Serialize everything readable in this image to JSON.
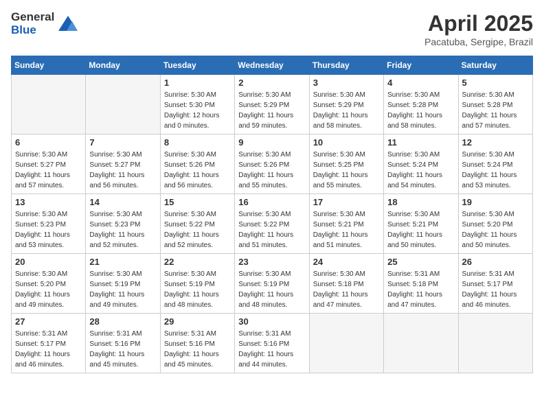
{
  "header": {
    "logo_general": "General",
    "logo_blue": "Blue",
    "month_title": "April 2025",
    "subtitle": "Pacatuba, Sergipe, Brazil"
  },
  "weekdays": [
    "Sunday",
    "Monday",
    "Tuesday",
    "Wednesday",
    "Thursday",
    "Friday",
    "Saturday"
  ],
  "weeks": [
    [
      {
        "day": "",
        "sunrise": "",
        "sunset": "",
        "daylight": ""
      },
      {
        "day": "",
        "sunrise": "",
        "sunset": "",
        "daylight": ""
      },
      {
        "day": "1",
        "sunrise": "Sunrise: 5:30 AM",
        "sunset": "Sunset: 5:30 PM",
        "daylight": "Daylight: 12 hours and 0 minutes."
      },
      {
        "day": "2",
        "sunrise": "Sunrise: 5:30 AM",
        "sunset": "Sunset: 5:29 PM",
        "daylight": "Daylight: 11 hours and 59 minutes."
      },
      {
        "day": "3",
        "sunrise": "Sunrise: 5:30 AM",
        "sunset": "Sunset: 5:29 PM",
        "daylight": "Daylight: 11 hours and 58 minutes."
      },
      {
        "day": "4",
        "sunrise": "Sunrise: 5:30 AM",
        "sunset": "Sunset: 5:28 PM",
        "daylight": "Daylight: 11 hours and 58 minutes."
      },
      {
        "day": "5",
        "sunrise": "Sunrise: 5:30 AM",
        "sunset": "Sunset: 5:28 PM",
        "daylight": "Daylight: 11 hours and 57 minutes."
      }
    ],
    [
      {
        "day": "6",
        "sunrise": "Sunrise: 5:30 AM",
        "sunset": "Sunset: 5:27 PM",
        "daylight": "Daylight: 11 hours and 57 minutes."
      },
      {
        "day": "7",
        "sunrise": "Sunrise: 5:30 AM",
        "sunset": "Sunset: 5:27 PM",
        "daylight": "Daylight: 11 hours and 56 minutes."
      },
      {
        "day": "8",
        "sunrise": "Sunrise: 5:30 AM",
        "sunset": "Sunset: 5:26 PM",
        "daylight": "Daylight: 11 hours and 56 minutes."
      },
      {
        "day": "9",
        "sunrise": "Sunrise: 5:30 AM",
        "sunset": "Sunset: 5:26 PM",
        "daylight": "Daylight: 11 hours and 55 minutes."
      },
      {
        "day": "10",
        "sunrise": "Sunrise: 5:30 AM",
        "sunset": "Sunset: 5:25 PM",
        "daylight": "Daylight: 11 hours and 55 minutes."
      },
      {
        "day": "11",
        "sunrise": "Sunrise: 5:30 AM",
        "sunset": "Sunset: 5:24 PM",
        "daylight": "Daylight: 11 hours and 54 minutes."
      },
      {
        "day": "12",
        "sunrise": "Sunrise: 5:30 AM",
        "sunset": "Sunset: 5:24 PM",
        "daylight": "Daylight: 11 hours and 53 minutes."
      }
    ],
    [
      {
        "day": "13",
        "sunrise": "Sunrise: 5:30 AM",
        "sunset": "Sunset: 5:23 PM",
        "daylight": "Daylight: 11 hours and 53 minutes."
      },
      {
        "day": "14",
        "sunrise": "Sunrise: 5:30 AM",
        "sunset": "Sunset: 5:23 PM",
        "daylight": "Daylight: 11 hours and 52 minutes."
      },
      {
        "day": "15",
        "sunrise": "Sunrise: 5:30 AM",
        "sunset": "Sunset: 5:22 PM",
        "daylight": "Daylight: 11 hours and 52 minutes."
      },
      {
        "day": "16",
        "sunrise": "Sunrise: 5:30 AM",
        "sunset": "Sunset: 5:22 PM",
        "daylight": "Daylight: 11 hours and 51 minutes."
      },
      {
        "day": "17",
        "sunrise": "Sunrise: 5:30 AM",
        "sunset": "Sunset: 5:21 PM",
        "daylight": "Daylight: 11 hours and 51 minutes."
      },
      {
        "day": "18",
        "sunrise": "Sunrise: 5:30 AM",
        "sunset": "Sunset: 5:21 PM",
        "daylight": "Daylight: 11 hours and 50 minutes."
      },
      {
        "day": "19",
        "sunrise": "Sunrise: 5:30 AM",
        "sunset": "Sunset: 5:20 PM",
        "daylight": "Daylight: 11 hours and 50 minutes."
      }
    ],
    [
      {
        "day": "20",
        "sunrise": "Sunrise: 5:30 AM",
        "sunset": "Sunset: 5:20 PM",
        "daylight": "Daylight: 11 hours and 49 minutes."
      },
      {
        "day": "21",
        "sunrise": "Sunrise: 5:30 AM",
        "sunset": "Sunset: 5:19 PM",
        "daylight": "Daylight: 11 hours and 49 minutes."
      },
      {
        "day": "22",
        "sunrise": "Sunrise: 5:30 AM",
        "sunset": "Sunset: 5:19 PM",
        "daylight": "Daylight: 11 hours and 48 minutes."
      },
      {
        "day": "23",
        "sunrise": "Sunrise: 5:30 AM",
        "sunset": "Sunset: 5:19 PM",
        "daylight": "Daylight: 11 hours and 48 minutes."
      },
      {
        "day": "24",
        "sunrise": "Sunrise: 5:30 AM",
        "sunset": "Sunset: 5:18 PM",
        "daylight": "Daylight: 11 hours and 47 minutes."
      },
      {
        "day": "25",
        "sunrise": "Sunrise: 5:31 AM",
        "sunset": "Sunset: 5:18 PM",
        "daylight": "Daylight: 11 hours and 47 minutes."
      },
      {
        "day": "26",
        "sunrise": "Sunrise: 5:31 AM",
        "sunset": "Sunset: 5:17 PM",
        "daylight": "Daylight: 11 hours and 46 minutes."
      }
    ],
    [
      {
        "day": "27",
        "sunrise": "Sunrise: 5:31 AM",
        "sunset": "Sunset: 5:17 PM",
        "daylight": "Daylight: 11 hours and 46 minutes."
      },
      {
        "day": "28",
        "sunrise": "Sunrise: 5:31 AM",
        "sunset": "Sunset: 5:16 PM",
        "daylight": "Daylight: 11 hours and 45 minutes."
      },
      {
        "day": "29",
        "sunrise": "Sunrise: 5:31 AM",
        "sunset": "Sunset: 5:16 PM",
        "daylight": "Daylight: 11 hours and 45 minutes."
      },
      {
        "day": "30",
        "sunrise": "Sunrise: 5:31 AM",
        "sunset": "Sunset: 5:16 PM",
        "daylight": "Daylight: 11 hours and 44 minutes."
      },
      {
        "day": "",
        "sunrise": "",
        "sunset": "",
        "daylight": ""
      },
      {
        "day": "",
        "sunrise": "",
        "sunset": "",
        "daylight": ""
      },
      {
        "day": "",
        "sunrise": "",
        "sunset": "",
        "daylight": ""
      }
    ]
  ]
}
